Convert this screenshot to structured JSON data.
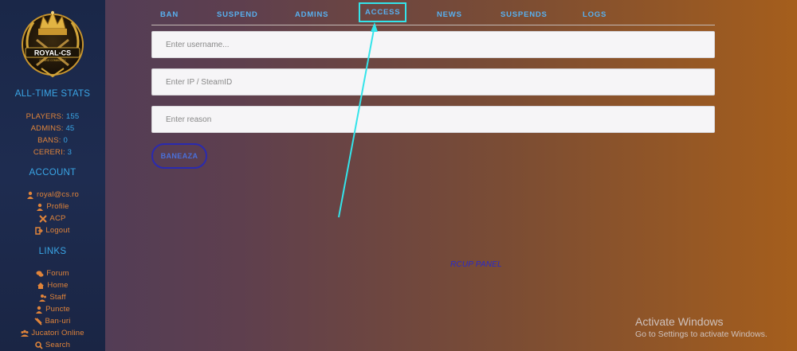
{
  "sidebar": {
    "logo_text": "ROYAL-CS",
    "logo_tagline": "GAMING COMMUNITY",
    "stats_title": "ALL-TIME STATS",
    "stats": [
      {
        "label": "PLAYERS:",
        "value": "155"
      },
      {
        "label": "ADMINS:",
        "value": "45"
      },
      {
        "label": "BANS:",
        "value": "0"
      },
      {
        "label": "CERERI:",
        "value": "3"
      }
    ],
    "account_title": "ACCOUNT",
    "account": [
      {
        "label": "royal@cs.ro",
        "icon": "user-icon"
      },
      {
        "label": "Profile",
        "icon": "user-icon"
      },
      {
        "label": "ACP",
        "icon": "tools-icon"
      },
      {
        "label": "Logout",
        "icon": "logout-icon"
      }
    ],
    "links_title": "LINKS",
    "links": [
      {
        "label": "Forum",
        "icon": "chat-icon"
      },
      {
        "label": "Home",
        "icon": "home-icon"
      },
      {
        "label": "Staff",
        "icon": "users-icon"
      },
      {
        "label": "Puncte",
        "icon": "user-icon"
      },
      {
        "label": "Ban-uri",
        "icon": "ban-icon"
      },
      {
        "label": "Jucatori Online",
        "icon": "group-icon"
      },
      {
        "label": "Search",
        "icon": "search-icon"
      }
    ]
  },
  "nav": {
    "tabs": [
      "BAN",
      "SUSPEND",
      "ADMINS",
      "ACCESS",
      "NEWS",
      "SUSPENDS",
      "LOGS"
    ],
    "active": "ACCESS"
  },
  "form": {
    "username_placeholder": "Enter username...",
    "ip_placeholder": "Enter IP / SteamID",
    "reason_placeholder": "Enter reason",
    "submit_label": "BANEAZA"
  },
  "footer": {
    "text": "RCUP PANEL"
  },
  "watermark": {
    "title": "Activate Windows",
    "subtitle": "Go to Settings to activate Windows."
  },
  "colors": {
    "accent": "#3aa6e6",
    "orange": "#e0843a",
    "highlight": "#33e4ea"
  }
}
